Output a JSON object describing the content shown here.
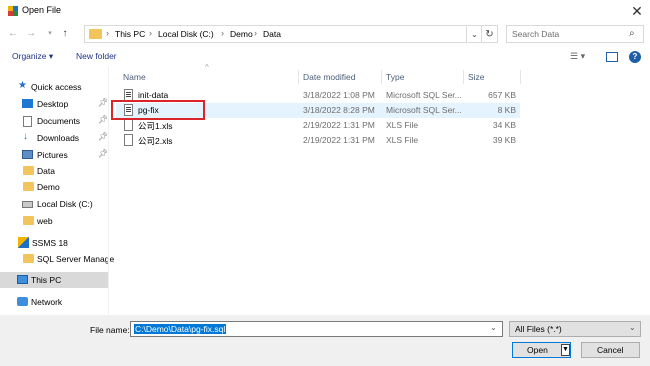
{
  "window": {
    "title": "Open File"
  },
  "address": {
    "crumbs": [
      "This PC",
      "Local Disk (C:)",
      "Demo",
      "Data"
    ],
    "separator": "›"
  },
  "search": {
    "placeholder": "Search Data"
  },
  "toolbar": {
    "organize": "Organize ▾",
    "new_folder": "New folder"
  },
  "sidebar": {
    "items": [
      {
        "label": "Quick access"
      },
      {
        "label": "Desktop"
      },
      {
        "label": "Documents"
      },
      {
        "label": "Downloads"
      },
      {
        "label": "Pictures"
      },
      {
        "label": "Data"
      },
      {
        "label": "Demo"
      },
      {
        "label": "Local Disk (C:)"
      },
      {
        "label": "web"
      },
      {
        "label": "SSMS 18"
      },
      {
        "label": "SQL Server Manage"
      },
      {
        "label": "This PC"
      },
      {
        "label": "Network"
      }
    ]
  },
  "columns": [
    "Name",
    "Date modified",
    "Type",
    "Size"
  ],
  "files": [
    {
      "name": "init-data",
      "date": "3/18/2022 1:08 PM",
      "type": "Microsoft SQL Ser...",
      "size": "657 KB"
    },
    {
      "name": "pg-fix",
      "date": "3/18/2022 8:28 PM",
      "type": "Microsoft SQL Ser...",
      "size": "8 KB"
    },
    {
      "name": "公司1.xls",
      "date": "2/19/2022 1:31 PM",
      "type": "XLS File",
      "size": "34 KB"
    },
    {
      "name": "公司2.xls",
      "date": "2/19/2022 1:31 PM",
      "type": "XLS File",
      "size": "39 KB"
    }
  ],
  "footer": {
    "file_name_label": "File name:",
    "file_name_value": "C:\\Demo\\Data\\pg-fix.sql",
    "filter": "All Files (*.*)",
    "open": "Open",
    "cancel": "Cancel"
  },
  "colors": {
    "accent": "#0078d7",
    "highlight": "#e5f3ff",
    "annotation": "#d9242a"
  }
}
